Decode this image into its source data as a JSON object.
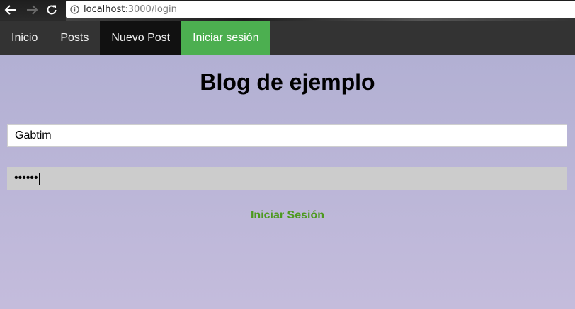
{
  "browser": {
    "url_host": "localhost",
    "url_rest": ":3000/login",
    "icons": {
      "back": "arrow-left-icon",
      "forward": "arrow-right-icon",
      "reload": "reload-icon",
      "info": "info-icon"
    }
  },
  "nav": {
    "items": [
      {
        "label": "Inicio"
      },
      {
        "label": "Posts"
      },
      {
        "label": "Nuevo Post"
      },
      {
        "label": "Iniciar sesión"
      }
    ]
  },
  "main": {
    "title": "Blog de ejemplo",
    "username_value": "Gabtim",
    "password_value": "••••••",
    "submit_label": "Iniciar Sesión"
  },
  "colors": {
    "nav_bg": "#333333",
    "nav_active": "#4caf50",
    "nav_hover": "#111111",
    "page_bg": "#b3b0d3",
    "submit_text": "#4d9a1f"
  }
}
